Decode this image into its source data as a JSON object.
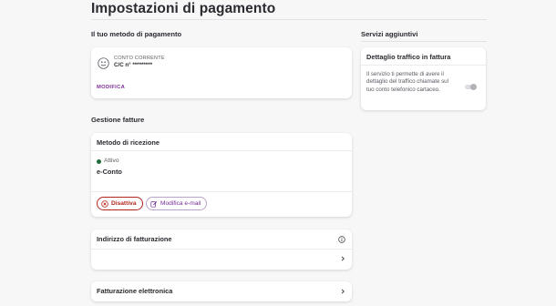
{
  "page": {
    "title": "Impostazioni di pagamento"
  },
  "payment": {
    "section_label": "Il tuo metodo di pagamento",
    "type": "CONTO CORRENTE",
    "number": "C/C n° *********",
    "edit_label": "MODIFICA",
    "icon": "bank-account-icon"
  },
  "invoices": {
    "section_label": "Gestione fatture",
    "reception": {
      "header": "Metodo di ricezione",
      "status": "Attivo",
      "status_color": "#1f6b3a",
      "method": "e-Conto",
      "deactivate_label": "Disattiva",
      "edit_email_label": "Modifica e-mail"
    },
    "billing_address": {
      "header": "Indirizzo di fatturazione",
      "icon": "info-icon"
    },
    "e_invoicing": {
      "header": "Fatturazione elettronica"
    }
  },
  "services": {
    "section_label": "Servizi aggiuntivi",
    "traffic_detail": {
      "header": "Dettaglio traffico in fattura",
      "description": "Il servizio ti permette di avere il dettaglio del traffico chiamate sul tuo conto telefonico cartaceo.",
      "enabled": false
    }
  },
  "colors": {
    "accent": "#7c2d99",
    "danger": "#b3261e"
  }
}
